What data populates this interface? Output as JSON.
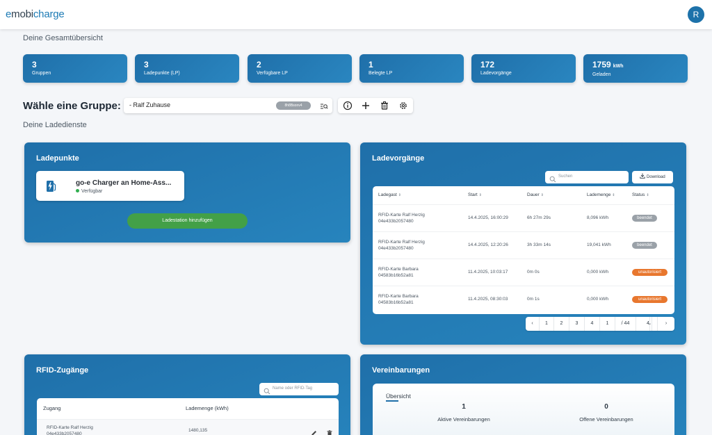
{
  "app": {
    "logo_part1": "e",
    "logo_part2": "mobi",
    "logo_part3": "charge",
    "avatar_initial": "R"
  },
  "overview_label": "Deine Gesamtübersicht",
  "stats": [
    {
      "value": "3",
      "unit": "",
      "label": "Gruppen"
    },
    {
      "value": "3",
      "unit": "",
      "label": "Ladepunkte (LP)"
    },
    {
      "value": "2",
      "unit": "",
      "label": "Verfügbare LP"
    },
    {
      "value": "1",
      "unit": "",
      "label": "Belegte LP"
    },
    {
      "value": "172",
      "unit": "",
      "label": "Ladevorgänge"
    },
    {
      "value": "1759",
      "unit": "kWh",
      "label": "Geladen"
    }
  ],
  "group": {
    "title": "Wähle eine Gruppe:",
    "selected": "- Ralf Zuhause",
    "chip": "8h8Bsonv4"
  },
  "services_label": "Deine Ladedienste",
  "ladepunkte": {
    "title": "Ladepunkte",
    "charger_name": "go-e Charger an Home-Ass...",
    "charger_status": "Verfügbar",
    "add_label": "Ladestation hinzufügen"
  },
  "ladevorgaenge": {
    "title": "Ladevorgänge",
    "search_placeholder": "Suchen",
    "download_label": "Download",
    "columns": [
      "Ladegast",
      "Start",
      "Dauer",
      "Lademenge",
      "Status"
    ],
    "rows": [
      {
        "guest": "RFID-Karte Ralf Herzig",
        "tag": "04e433b2057480",
        "start": "14.4.2025, 16:00:29",
        "duration": "6h 27m 29s",
        "amount": "8,096 kWh",
        "status": "beendet",
        "status_color": "#9aa1a8"
      },
      {
        "guest": "RFID-Karte Ralf Herzig",
        "tag": "04e433b2057480",
        "start": "14.4.2025, 12:20:26",
        "duration": "3h 33m 14s",
        "amount": "19,041 kWh",
        "status": "beendet",
        "status_color": "#9aa1a8"
      },
      {
        "guest": "RFID-Karte Barbara",
        "tag": "04583b16b52a81",
        "start": "11.4.2025, 10:03:17",
        "duration": "0m 0s",
        "amount": "0,000 kWh",
        "status": "unautorisiert",
        "status_color": "#e8772e"
      },
      {
        "guest": "RFID-Karte Barbara",
        "tag": "04583b16b52a81",
        "start": "11.4.2025, 08:30:03",
        "duration": "0m 1s",
        "amount": "0,000 kWh",
        "status": "unautorisiert",
        "status_color": "#e8772e"
      }
    ],
    "pager": {
      "prev": "‹",
      "pages": [
        "1",
        "2",
        "3",
        "4"
      ],
      "current": "1",
      "total": "/ 44",
      "per_page": "4",
      "next": "›"
    }
  },
  "rfid": {
    "title": "RFID-Zugänge",
    "search_placeholder": "Name oder RFID-Tag",
    "columns": [
      "Zugang",
      "Lademenge (kWh)"
    ],
    "rows": [
      {
        "name": "RFID-Karte Ralf Herzig",
        "tag": "04e433b2057480",
        "amount": "1480,135"
      }
    ]
  },
  "vereinbarungen": {
    "title": "Vereinbarungen",
    "tab": "Übersicht",
    "active_count": "1",
    "active_label": "Aktive Vereinbarungen",
    "open_count": "0",
    "open_label": "Offene Vereinbarungen"
  },
  "colors": {
    "brand": "#1d7bb5",
    "card_bg": "#1f6fa9",
    "success": "#43a047",
    "available_dot": "#2fae4e"
  }
}
